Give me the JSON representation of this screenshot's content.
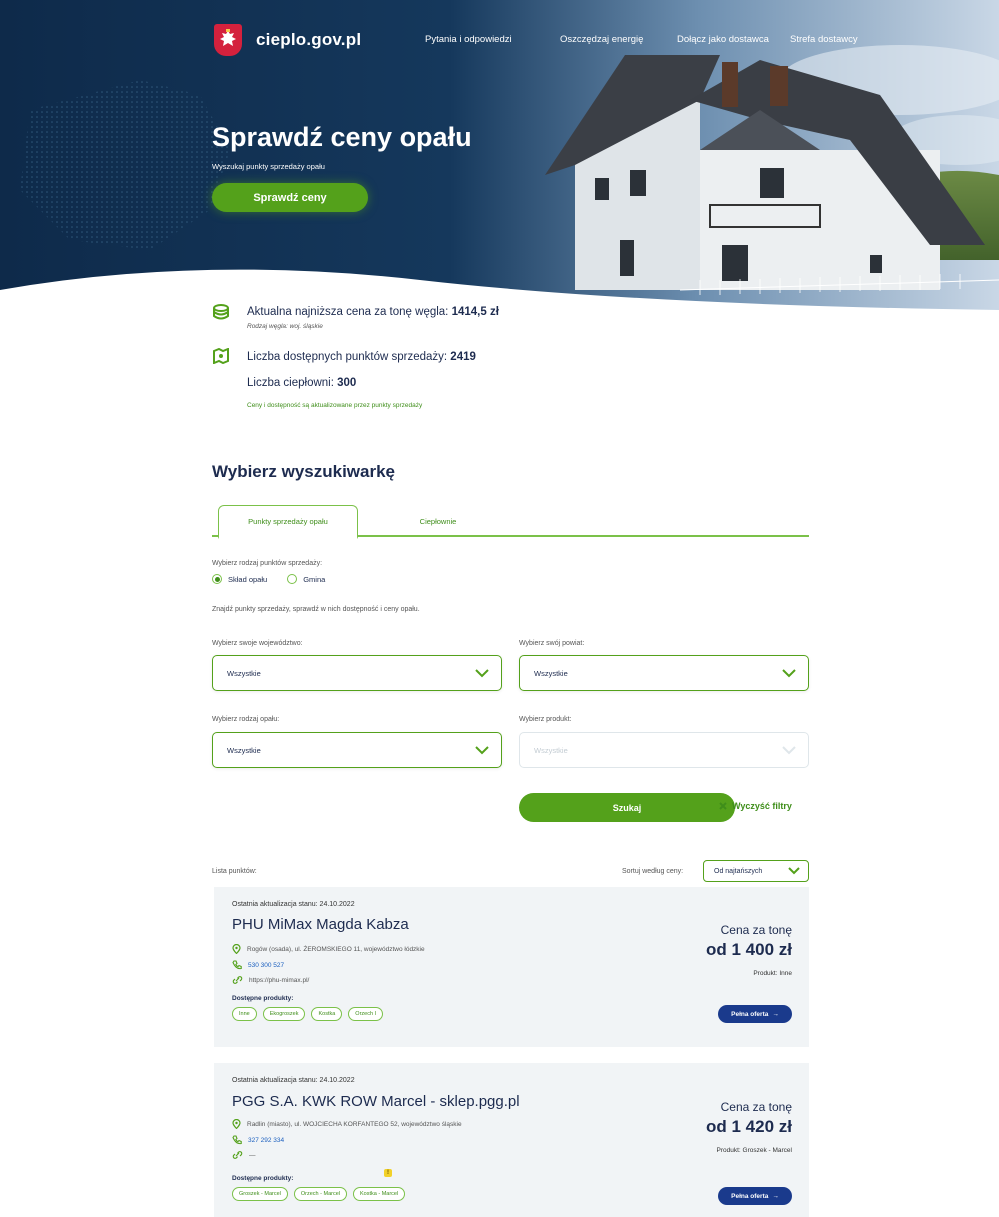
{
  "brand": {
    "site_name": "cieplo.gov.pl",
    "accent_green": "#54a11b",
    "navy": "#1d2b4f",
    "blue_button": "#1a3a8c"
  },
  "nav": {
    "links": [
      "Pytania i odpowiedzi",
      "Oszczędzaj energię",
      "Dołącz jako dostawca",
      "Strefa dostawcy"
    ]
  },
  "hero": {
    "title": "Sprawdź ceny opału",
    "subtitle": "Wyszukaj punkty sprzedaży opału",
    "button": "Sprawdź ceny"
  },
  "stats": {
    "coal_price_label": "Aktualna najniższa cena za tonę węgla:",
    "coal_price_value": "1414,5 zł",
    "coal_type_note": "Rodzaj węgla: woj. śląskie",
    "points_label": "Liczba dostępnych punktów sprzedaży:",
    "points_value": "2419",
    "plants_label": "Liczba ciepłowni:",
    "plants_value": "300",
    "update_note": "Ceny i dostępność są aktualizowane przez punkty sprzedaży"
  },
  "search": {
    "title": "Wybierz wyszukiwarkę",
    "tabs": [
      "Punkty sprzedaży opału",
      "Ciepłownie"
    ],
    "point_type_label": "Wybierz rodzaj punktów sprzedaży:",
    "point_type_options": [
      "Skład opału",
      "Gmina"
    ],
    "hint": "Znajdź punkty sprzedaży, sprawdź w nich dostępność i ceny opału.",
    "voivodeship_label": "Wybierz swoje województwo:",
    "voivodeship_value": "Wszystkie",
    "county_label": "Wybierz swój powiat:",
    "county_value": "Wszystkie",
    "fuel_label": "Wybierz rodzaj opału:",
    "fuel_value": "Wszystkie",
    "product_label": "Wybierz produkt:",
    "product_placeholder": "Wszystkie",
    "search_button": "Szukaj",
    "clear_filters": "Wyczyść filtry"
  },
  "list": {
    "label": "Lista punktów:",
    "sort_label": "Sortuj według ceny:",
    "sort_value": "Od najtańszych",
    "items": [
      {
        "updated": "Ostatnia aktualizacja stanu: 24.10.2022",
        "name": "PHU MiMax Magda Kabza",
        "address": "Rogów (osada), ul. ŻEROMSKIEGO 11, województwo łódzkie",
        "phone": "530 300 527",
        "website": "https://phu-mimax.pl/",
        "products_label": "Dostępne produkty:",
        "products": [
          "Inne",
          "Ekogroszek",
          "Kostka",
          "Orzech I"
        ],
        "price_label": "Cena za tonę",
        "price": "od 1 400 zł",
        "product": "Produkt: Inne",
        "offer_button": "Pełna oferta"
      },
      {
        "updated": "Ostatnia aktualizacja stanu: 24.10.2022",
        "name": "PGG S.A. KWK ROW Marcel - sklep.pgg.pl",
        "address": "Radlin (miasto), ul. WOJCIECHA KORFANTEGO 52, województwo śląskie",
        "phone": "327 292 334",
        "website": "—",
        "products_label": "Dostępne produkty:",
        "products": [
          "Groszek - Marcel",
          "Orzech - Marcel",
          "Kostka - Marcel"
        ],
        "price_label": "Cena za tonę",
        "price": "od 1 420 zł",
        "product": "Produkt: Groszek - Marcel",
        "offer_button": "Pełna oferta",
        "warning": "!"
      }
    ]
  }
}
